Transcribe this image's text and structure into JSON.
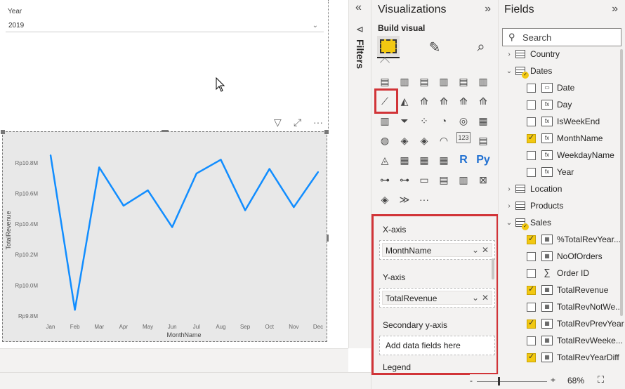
{
  "slicer": {
    "label": "Year",
    "value": "2019"
  },
  "chart_data": {
    "type": "line",
    "categories": [
      "Jan",
      "Feb",
      "Mar",
      "Apr",
      "May",
      "Jun",
      "Jul",
      "Aug",
      "Sep",
      "Oct",
      "Nov",
      "Dec"
    ],
    "series": [
      {
        "values": [
          10.85,
          9.84,
          10.77,
          10.52,
          10.62,
          10.38,
          10.73,
          10.82,
          10.49,
          10.76,
          10.51,
          10.74
        ]
      }
    ],
    "xlabel": "MonthName",
    "ylabel": "TotalRevenue",
    "yticks": [
      "Rp9.8M",
      "Rp10.0M",
      "Rp10.2M",
      "Rp10.4M",
      "Rp10.6M",
      "Rp10.8M"
    ],
    "ylim": [
      9.8,
      10.9
    ],
    "line_color": "#118dff",
    "grid": false
  },
  "filters": {
    "title": "Filters",
    "collapse_icon": "«",
    "funnel_icon": "⊲"
  },
  "viz": {
    "title": "Visualizations",
    "expand_icon": "»",
    "build_visual": "Build visual",
    "xaxis_label": "X-axis",
    "xaxis_field": "MonthName",
    "yaxis_label": "Y-axis",
    "yaxis_field": "TotalRevenue",
    "secondary_label": "Secondary y-axis",
    "secondary_placeholder": "Add data fields here",
    "legend_label": "Legend",
    "grid_icons": [
      [
        "▤",
        "▥",
        "▤",
        "▥",
        "▤",
        "▥"
      ],
      [
        "⟋",
        "◭",
        "⟰",
        "⟰",
        "⟰",
        "⟰"
      ],
      [
        "▥",
        "⏷",
        "⁘",
        "◔",
        "◎",
        "▦"
      ],
      [
        "◍",
        "◈",
        "◈",
        "◠",
        "123",
        "▤"
      ],
      [
        "◬",
        "▦",
        "▦",
        "▦",
        "R",
        "Py"
      ],
      [
        "⊶",
        "⊶",
        "▭",
        "▤",
        "▥",
        "⊠"
      ],
      [
        "◈",
        "≫",
        "···",
        "",
        "",
        ""
      ]
    ]
  },
  "fields": {
    "title": "Fields",
    "expand_icon": "»",
    "search_placeholder": "Search",
    "rows": [
      {
        "type": "table",
        "label": "Country",
        "arrow": "›",
        "indent": 0
      },
      {
        "type": "table",
        "label": "Dates",
        "arrow": "⌄",
        "indent": 0,
        "check": true
      },
      {
        "type": "field",
        "label": "Date",
        "icon": "▭",
        "checked": false
      },
      {
        "type": "field",
        "label": "Day",
        "icon": "fx",
        "checked": false
      },
      {
        "type": "field",
        "label": "IsWeekEnd",
        "icon": "fx",
        "checked": false
      },
      {
        "type": "field",
        "label": "MonthName",
        "icon": "fx",
        "checked": true
      },
      {
        "type": "field",
        "label": "WeekdayName",
        "icon": "fx",
        "checked": false
      },
      {
        "type": "field",
        "label": "Year",
        "icon": "fx",
        "checked": false
      },
      {
        "type": "table",
        "label": "Location",
        "arrow": "›",
        "indent": 0
      },
      {
        "type": "table",
        "label": "Products",
        "arrow": "›",
        "indent": 0
      },
      {
        "type": "table",
        "label": "Sales",
        "arrow": "⌄",
        "indent": 0,
        "check": true
      },
      {
        "type": "field",
        "label": "%TotalRevYear...",
        "icon": "▦",
        "checked": true
      },
      {
        "type": "field",
        "label": "NoOfOrders",
        "icon": "▦",
        "checked": false
      },
      {
        "type": "field",
        "label": "Order ID",
        "icon": "∑",
        "checked": false
      },
      {
        "type": "field",
        "label": "TotalRevenue",
        "icon": "▦",
        "checked": true
      },
      {
        "type": "field",
        "label": "TotalRevNotWe...",
        "icon": "▦",
        "checked": false
      },
      {
        "type": "field",
        "label": "TotalRevPrevYear",
        "icon": "▦",
        "checked": true
      },
      {
        "type": "field",
        "label": "TotalRevWeeke...",
        "icon": "▦",
        "checked": false
      },
      {
        "type": "field",
        "label": "TotalRevYearDiff",
        "icon": "▦",
        "checked": true
      }
    ]
  },
  "status": {
    "zoom": "68%",
    "minus": "-",
    "plus": "+"
  }
}
